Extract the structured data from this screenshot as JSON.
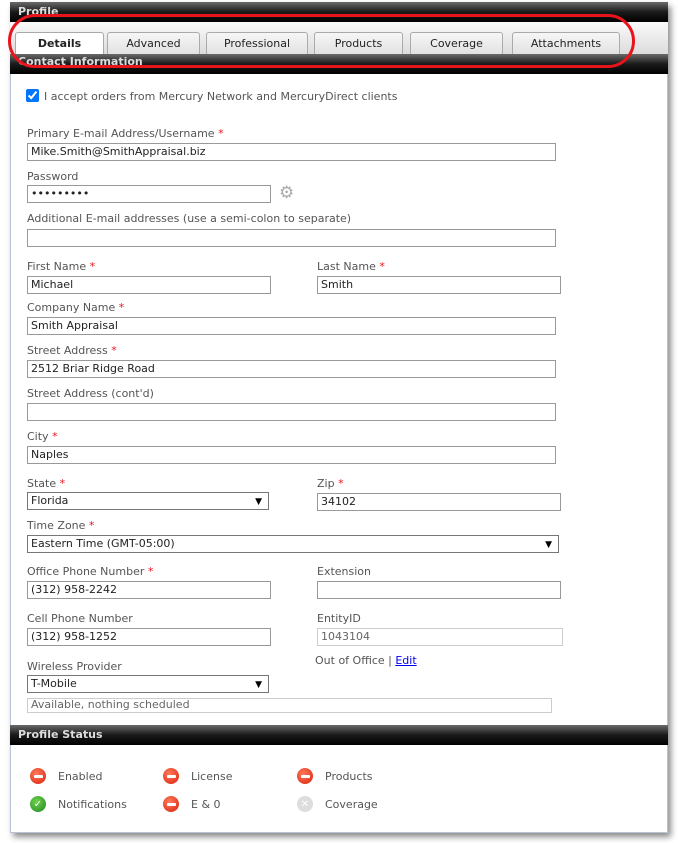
{
  "header": {
    "title": "Profile"
  },
  "tabs": [
    {
      "label": "Details",
      "active": true
    },
    {
      "label": "Advanced"
    },
    {
      "label": "Professional"
    },
    {
      "label": "Products"
    },
    {
      "label": "Coverage"
    },
    {
      "label": "Attachments"
    }
  ],
  "contact": {
    "title": "Contact Information",
    "accept_label": "I accept orders from Mercury Network and MercuryDirect clients",
    "accept_checked": true,
    "email_label": "Primary E-mail Address/Username",
    "email": "Mike.Smith@SmithAppraisal.biz",
    "password_label": "Password",
    "password": "•••••••••",
    "additional_label": "Additional E-mail addresses (use a semi-colon to separate)",
    "additional": "",
    "first_label": "First Name",
    "first": "Michael",
    "last_label": "Last Name",
    "last": "Smith",
    "company_label": "Company Name",
    "company": "Smith Appraisal",
    "street_label": "Street Address",
    "street": "2512 Briar Ridge Road",
    "street2_label": "Street Address (cont'd)",
    "street2": "",
    "city_label": "City",
    "city": "Naples",
    "state_label": "State",
    "state": "Florida",
    "zip_label": "Zip",
    "zip": "34102",
    "tz_label": "Time Zone",
    "tz": "Eastern Time (GMT-05:00)",
    "office_label": "Office Phone Number",
    "office": "(312) 958-2242",
    "ext_label": "Extension",
    "ext": "",
    "cell_label": "Cell Phone Number",
    "cell": "(312) 958-1252",
    "entity_label": "EntityID",
    "entity": "1043104",
    "ooo_label": "Out of Office |",
    "ooo_edit": "Edit",
    "wireless_label": "Wireless Provider",
    "wireless": "T-Mobile",
    "availability": "Available, nothing scheduled",
    "required_mark": "*"
  },
  "status": {
    "title": "Profile Status",
    "items": [
      {
        "label": "Enabled",
        "state": "error"
      },
      {
        "label": "License",
        "state": "error"
      },
      {
        "label": "Products",
        "state": "error"
      },
      {
        "label": "Notifications",
        "state": "ok"
      },
      {
        "label": "E & 0",
        "state": "error"
      },
      {
        "label": "Coverage",
        "state": "disabled"
      }
    ]
  },
  "colors": {
    "highlight_ring": "#e8141c",
    "error": "#d8220c",
    "ok": "#1f8a1f",
    "link": "#0000ee"
  }
}
